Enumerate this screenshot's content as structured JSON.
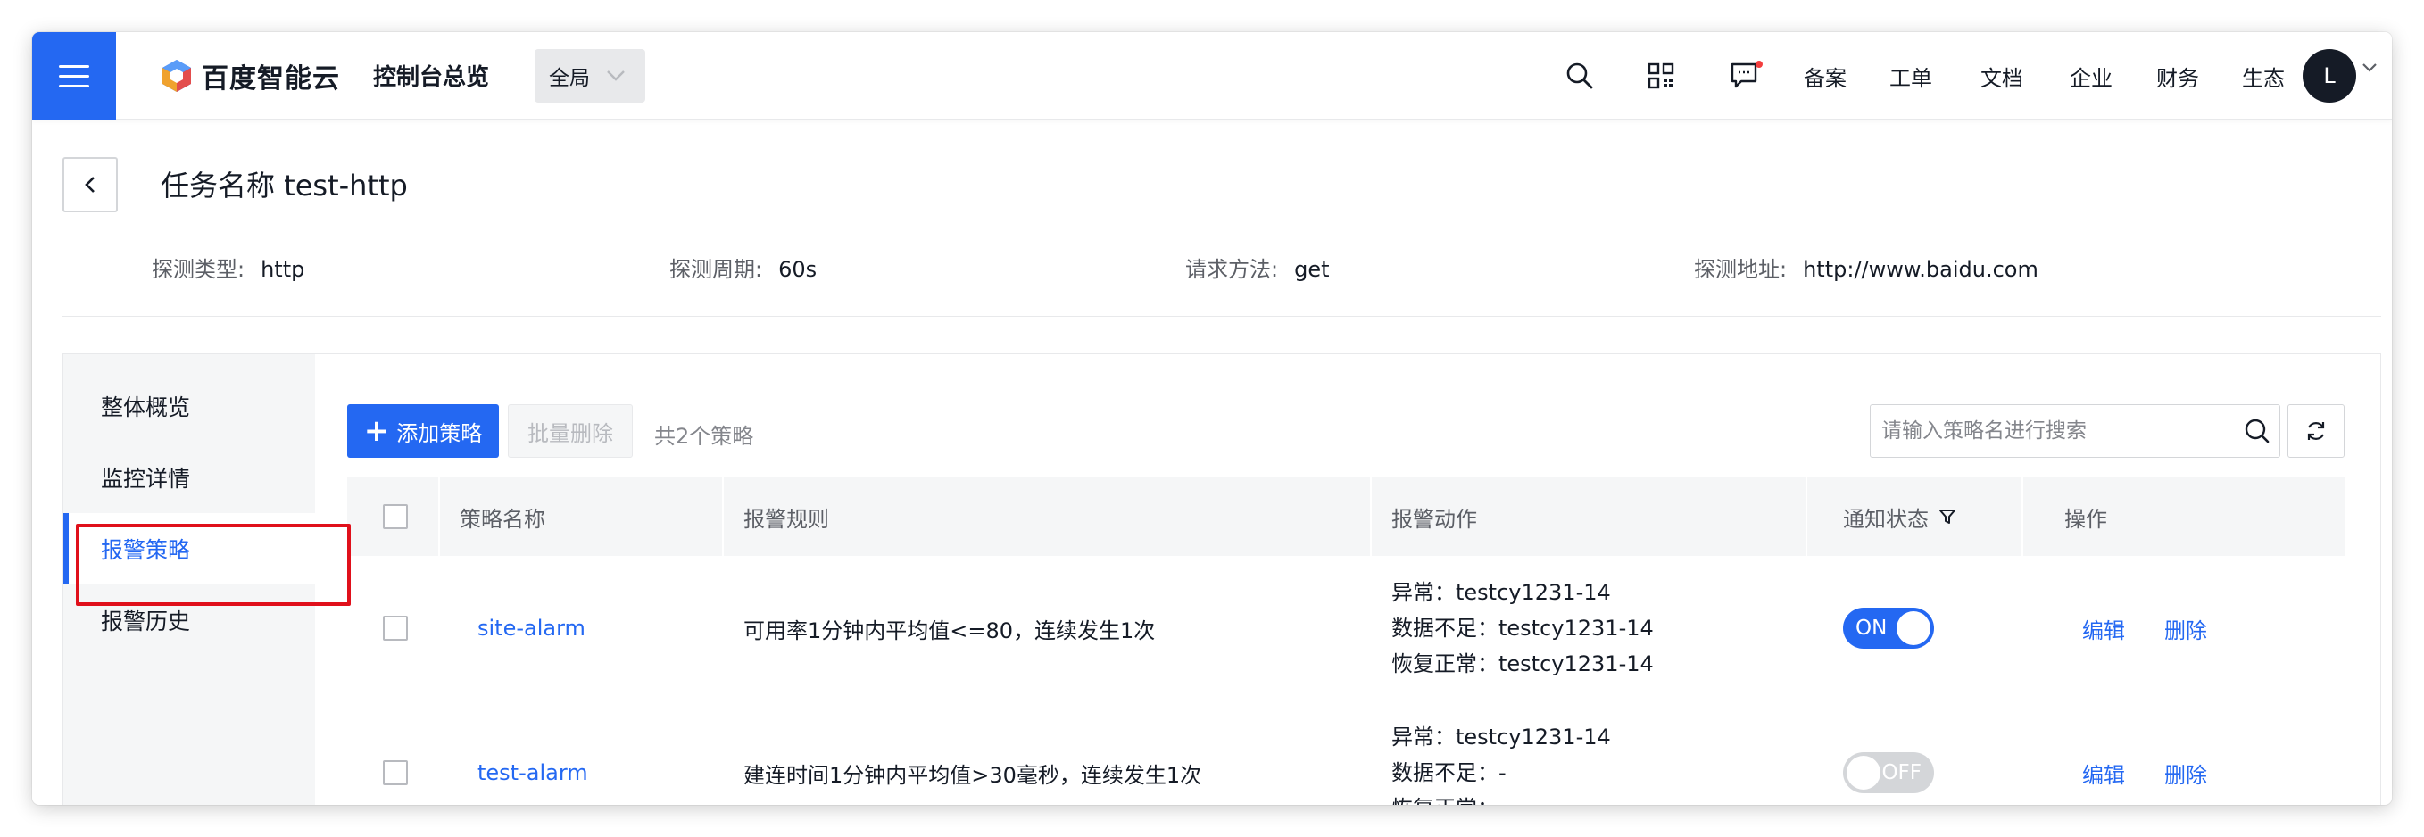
{
  "topbar": {
    "logo_text": "百度智能云",
    "console_title": "控制台总览",
    "region_label": "全局",
    "links": [
      "备案",
      "工单",
      "文档",
      "企业",
      "财务",
      "生态"
    ],
    "avatar_letter": "L",
    "colors": {
      "brand": "#2468f2",
      "notify_dot": "#f33e3e"
    }
  },
  "header": {
    "task_title": "任务名称 test-http",
    "info": [
      {
        "label": "探测类型:",
        "value": "http"
      },
      {
        "label": "探测周期:",
        "value": "60s"
      },
      {
        "label": "请求方法:",
        "value": "get"
      },
      {
        "label": "探测地址:",
        "value": "http://www.baidu.com"
      }
    ]
  },
  "sidenav": {
    "items": [
      {
        "label": "整体概览",
        "active": false
      },
      {
        "label": "监控详情",
        "active": false
      },
      {
        "label": "报警策略",
        "active": true
      },
      {
        "label": "报警历史",
        "active": false
      }
    ]
  },
  "toolbar": {
    "add_label": "添加策略",
    "batch_delete_label": "批量删除",
    "count_text": "共2个策略",
    "search_placeholder": "请输入策略名进行搜索"
  },
  "table": {
    "columns": [
      "策略名称",
      "报警规则",
      "报警动作",
      "通知状态",
      "操作"
    ],
    "rows": [
      {
        "name": "site-alarm",
        "rule": "可用率1分钟内平均值<=80，连续发生1次",
        "actions": [
          "异常：testcy1231-14",
          "数据不足：testcy1231-14",
          "恢复正常：testcy1231-14"
        ],
        "status": "ON",
        "status_on": true,
        "edit": "编辑",
        "delete": "删除"
      },
      {
        "name": "test-alarm",
        "rule": "建连时间1分钟内平均值>30毫秒，连续发生1次",
        "actions": [
          "异常：testcy1231-14",
          "数据不足：-",
          "恢复正常：-"
        ],
        "status": "OFF",
        "status_on": false,
        "edit": "编辑",
        "delete": "删除"
      }
    ]
  }
}
